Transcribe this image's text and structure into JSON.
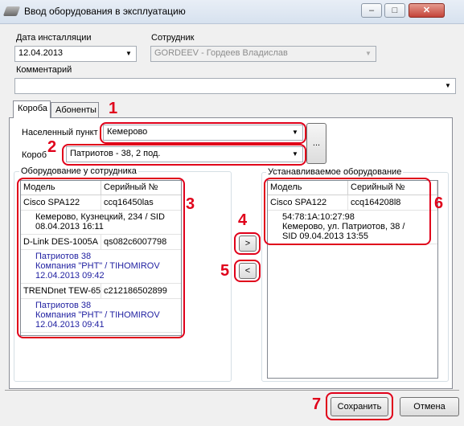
{
  "window": {
    "title": "Ввод оборудования в эксплуатацию",
    "minimize_glyph": "–",
    "maximize_glyph": "□",
    "close_glyph": "✕"
  },
  "form": {
    "install_date_label": "Дата инсталляции",
    "install_date_value": "12.04.2013",
    "employee_label": "Сотрудник",
    "employee_value": "GORDEEV - Гордеев Владислав",
    "comment_label": "Комментарий",
    "comment_value": ""
  },
  "tabs": [
    {
      "label": "Короба",
      "active": true
    },
    {
      "label": "Абоненты",
      "active": false
    }
  ],
  "korob_tab": {
    "city_label": "Населенный пункт",
    "city_value": "Кемерово",
    "box_label": "Короб",
    "box_value": "Патриотов - 38, 2 под.",
    "browse_label": "..."
  },
  "employee_equipment": {
    "title": "Оборудование у сотрудника",
    "col_model": "Модель",
    "col_serial": "Серийный №",
    "items": [
      {
        "model": "Cisco SPA122",
        "serial": "ccq16450las",
        "details": [
          "Кемерово, Кузнецкий, 234 / SID",
          "08.04.2013 16:11"
        ],
        "blue": false
      },
      {
        "model": "D-Link DES-1005A",
        "serial": "qs082c6007798",
        "details": [
          "Патриотов 38",
          "Компания \"РНТ\" / TIHOMIROV",
          "12.04.2013 09:42"
        ],
        "blue": true
      },
      {
        "model": "TRENDnet TEW-65",
        "serial": "c212186502899",
        "details": [
          "Патриотов 38",
          "Компания \"РНТ\" / TIHOMIROV",
          "12.04.2013 09:41"
        ],
        "blue": true
      }
    ]
  },
  "installed_equipment": {
    "title": "Устанавливаемое оборудование",
    "col_model": "Модель",
    "col_serial": "Серийный №",
    "items": [
      {
        "model": "Cisco SPA122",
        "serial": "ccq164208l8",
        "details": [
          "54:78:1A:10:27:98",
          "Кемерово, ул. Патриотов, 38 /",
          "SID 09.04.2013 13:55"
        ]
      }
    ]
  },
  "transfer": {
    "move_right_glyph": ">",
    "move_left_glyph": "<"
  },
  "buttons": {
    "save": "Сохранить",
    "cancel": "Отмена"
  },
  "annotations": [
    "1",
    "2",
    "3",
    "4",
    "5",
    "6",
    "7"
  ],
  "colors": {
    "annotation": "#e0001a",
    "blue_text": "#1e1ea0"
  }
}
